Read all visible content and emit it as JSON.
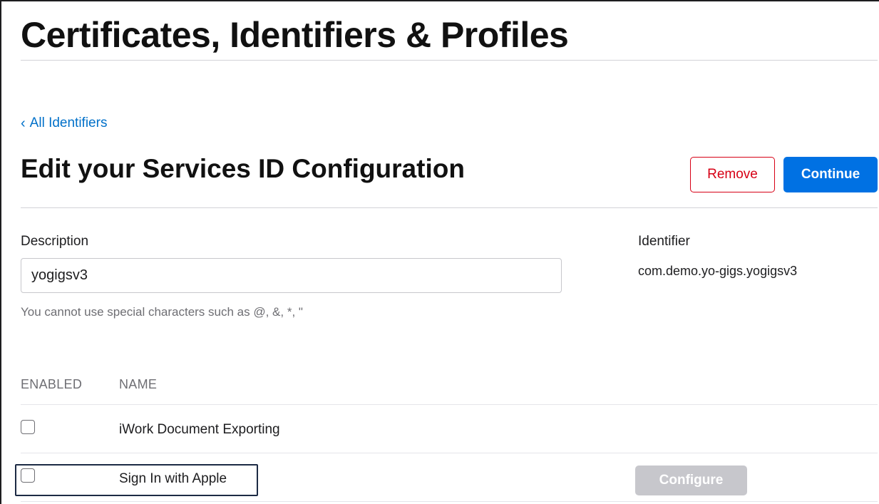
{
  "header": {
    "title": "Certificates, Identifiers & Profiles"
  },
  "nav": {
    "back_chevron": "‹",
    "back_label": "All Identifiers"
  },
  "section": {
    "title": "Edit your Services ID Configuration",
    "remove_label": "Remove",
    "continue_label": "Continue"
  },
  "form": {
    "description_label": "Description",
    "description_value": "yogigsv3",
    "hint": "You cannot use special characters such as @, &, *, \"",
    "identifier_label": "Identifier",
    "identifier_value": "com.demo.yo-gigs.yogigsv3"
  },
  "capabilities": {
    "headers": {
      "enabled": "ENABLED",
      "name": "NAME"
    },
    "rows": [
      {
        "name": "iWork Document Exporting",
        "enabled": false
      },
      {
        "name": "Sign In with Apple",
        "enabled": false,
        "action_label": "Configure",
        "action_disabled": true
      }
    ]
  },
  "colors": {
    "accent": "#0071e3",
    "link": "#0070c9",
    "destructive": "#d70015",
    "disabled": "#c7c7cc"
  }
}
